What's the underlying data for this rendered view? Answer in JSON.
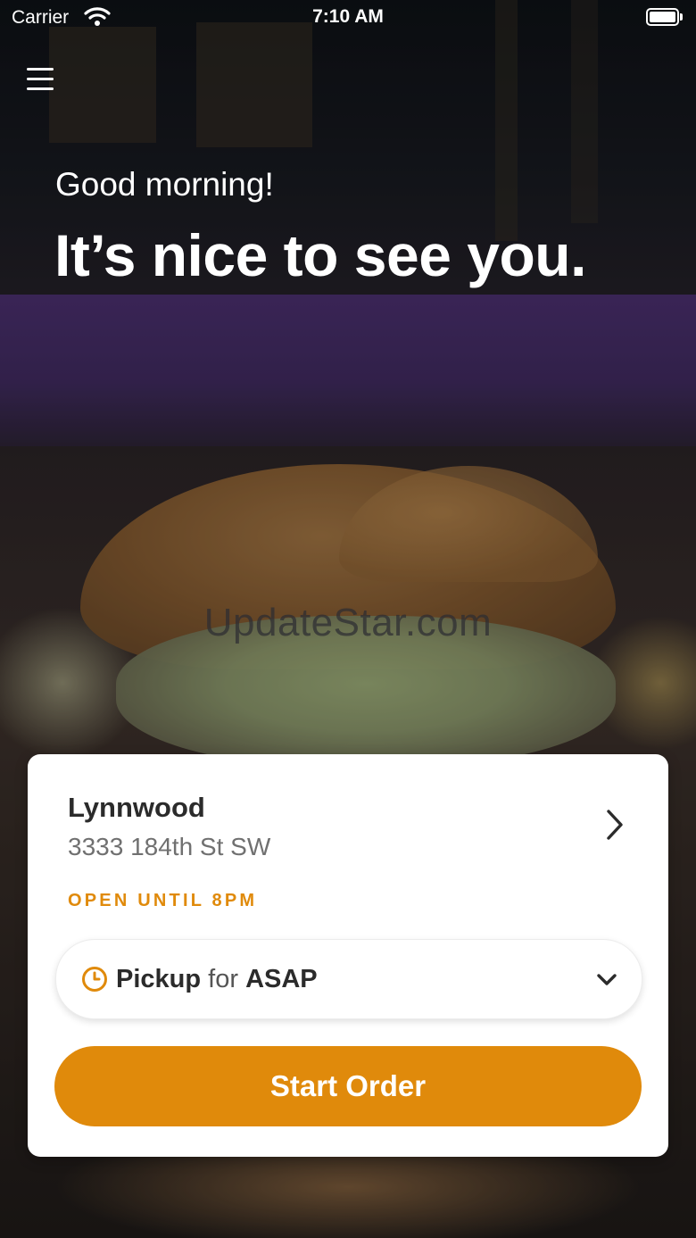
{
  "status_bar": {
    "carrier": "Carrier",
    "time": "7:10 AM",
    "wifi_icon": "wifi-icon",
    "battery_icon": "battery-icon"
  },
  "header": {
    "menu_icon": "hamburger-menu-icon",
    "greeting": "Good morning!",
    "headline": "It’s nice to see you."
  },
  "watermark": "UpdateStar.com",
  "card": {
    "location_name": "Lynnwood",
    "address": "3333 184th St SW",
    "open_status": "OPEN UNTIL 8PM",
    "chevron_icon": "chevron-right-icon",
    "order_mode": {
      "icon": "clock-icon",
      "type": "Pickup",
      "connector": "for",
      "time": "ASAP",
      "dropdown_icon": "chevron-down-icon"
    },
    "start_order_label": "Start Order"
  },
  "colors": {
    "accent": "#e08a0b",
    "card_background": "#ffffff",
    "primary_text": "#2b2b2b",
    "secondary_text": "#707070"
  }
}
